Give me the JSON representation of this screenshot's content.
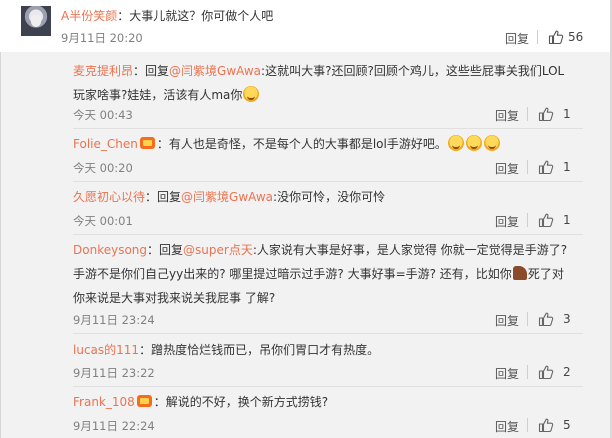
{
  "top_comment": {
    "username": "A半份笑颜",
    "text": "：大事儿就这？你可做个人吧",
    "time": "9月11日 20:20",
    "reply_label": "回复",
    "likes": "56"
  },
  "replies": [
    {
      "username": "麦克提利昂",
      "prefix": "：回复",
      "mention": "@闫紫境GwAwa",
      "text_line1": ":这就叫大事?还回顾?回顾个鸡儿，这些些屁事关我们LOL",
      "text_line2": "玩家啥事?娃娃，活该有人ma你",
      "emoji_count": 1,
      "time": "今天 00:43",
      "reply_label": "回复",
      "likes": "1"
    },
    {
      "username": "Folie_Chen",
      "badge": "vip",
      "text": "：有人也是奇怪，不是每个人的大事都是lol手游好吧。",
      "emoji_count": 3,
      "time": "今天 00:20",
      "reply_label": "回复",
      "likes": "1"
    },
    {
      "username": "久愿初心以待",
      "prefix": "：回复",
      "mention": "@闫紫境GwAwa",
      "text": ":没你可怜，没你可怜",
      "time": "今天 00:01",
      "reply_label": "回复",
      "likes": "1"
    },
    {
      "username": "Donkeysong",
      "prefix": "：回复",
      "mention": "@super点天",
      "text_line1": ":人家说有大事是好事，是人家觉得 你就一定觉得是手游了?",
      "text_line2": "手游不是你们自己yy出来的? 哪里提过暗示过手游? 大事好事=手游? 还有，比如你",
      "text_line2_tail": "死了对",
      "text_line3": "你来说是大事对我来说关我屁事 了解?",
      "time": "9月11日 23:24",
      "reply_label": "回复",
      "likes": "3"
    },
    {
      "username": "lucas的111",
      "text": "：蹭热度恰烂钱而已，吊你们胃口才有热度。",
      "time": "9月11日 23:22",
      "reply_label": "回复",
      "likes": "2"
    },
    {
      "username": "Frank_108",
      "badge": "vip",
      "text": "：解说的不好，换个新方式捞钱?",
      "time": "9月11日 22:24",
      "reply_label": "回复",
      "likes": "5"
    }
  ],
  "icons": {
    "like": "thumbs-up-icon",
    "badge": "vip-badge-icon",
    "emoji": "grin-emoji-icon",
    "sticker": "horse-sticker-icon"
  },
  "colors": {
    "username": "#eb7350",
    "mention": "#eb7350",
    "meta": "#808080",
    "background": "#f2f2f2"
  }
}
